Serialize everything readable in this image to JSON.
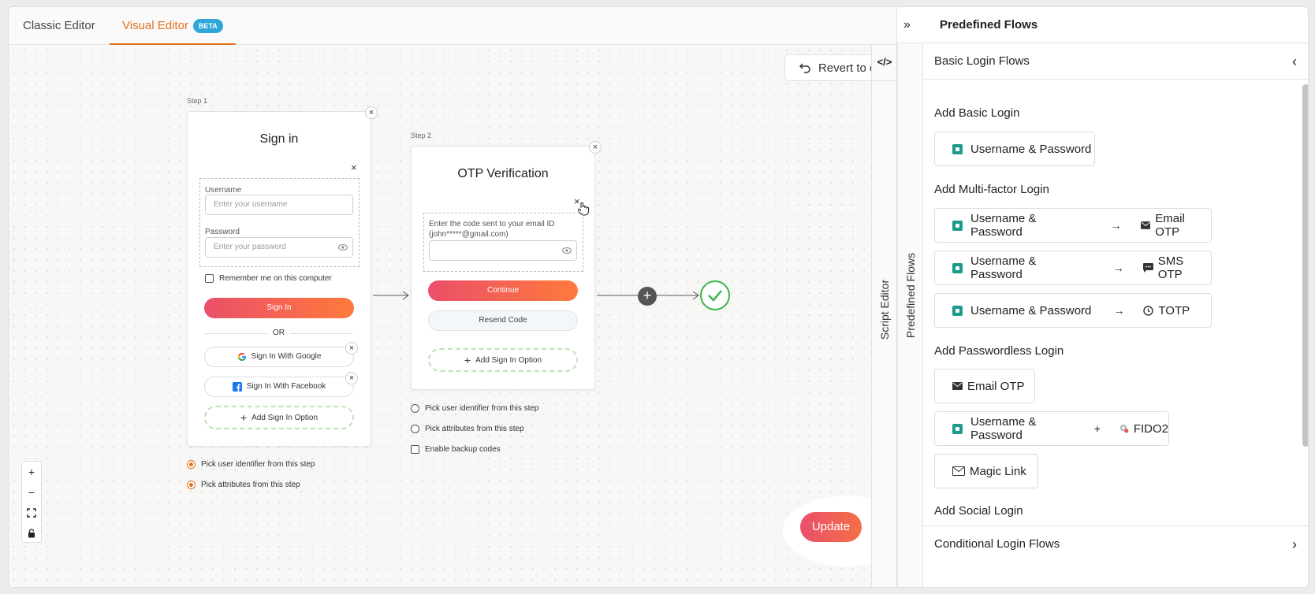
{
  "tabs": {
    "classic": "Classic Editor",
    "visual": "Visual Editor",
    "beta": "BETA"
  },
  "toolbar": {
    "revert": "Revert to default",
    "update": "Update"
  },
  "step1": {
    "label": "Step 1",
    "title": "Sign in",
    "username_label": "Username",
    "username_placeholder": "Enter your username",
    "password_label": "Password",
    "password_placeholder": "Enter your password",
    "remember": "Remember me on this computer",
    "sign_in": "Sign In",
    "or": "OR",
    "google": "Sign In With Google",
    "facebook": "Sign In With Facebook",
    "add_option": "Add Sign In Option",
    "options": [
      {
        "label": "Pick user identifier from this step",
        "checked": true
      },
      {
        "label": "Pick attributes from this step",
        "checked": true
      }
    ]
  },
  "step2": {
    "label": "Step 2",
    "title": "OTP Verification",
    "code_label": "Enter the code sent to your email ID (john*****@gmail.com)",
    "continue": "Continue",
    "resend": "Resend Code",
    "add_option": "Add Sign In Option",
    "options": [
      {
        "label": "Pick user identifier from this step",
        "checked": false
      },
      {
        "label": "Pick attributes from this step",
        "checked": false
      },
      {
        "label": "Enable backup codes",
        "checked": false
      }
    ]
  },
  "side_tabs": {
    "script_editor": "Script Editor",
    "predefined_flows": "Predefined Flows"
  },
  "panel": {
    "title": "Predefined Flows",
    "basic_section": "Basic Login Flows",
    "conditional_section": "Conditional Login Flows",
    "groups": {
      "basic": "Add Basic Login",
      "mfa": "Add Multi-factor Login",
      "passwordless": "Add Passwordless Login",
      "social": "Add Social Login"
    },
    "basic_flow": "Username & Password",
    "mfa_flows": [
      {
        "first": "Username & Password",
        "joiner": "→",
        "second": "Email OTP"
      },
      {
        "first": "Username & Password",
        "joiner": "→",
        "second": "SMS OTP"
      },
      {
        "first": "Username & Password",
        "joiner": "→",
        "second": "TOTP"
      }
    ],
    "passwordless_flows": {
      "email_otp": "Email OTP",
      "fido_first": "Username & Password",
      "fido_joiner": "+",
      "fido_second": "FIDO2",
      "magic_link": "Magic Link"
    }
  },
  "colors": {
    "accent": "#e4701e",
    "gradient_start": "#ea4f6a",
    "gradient_end": "#ff7a3c",
    "success": "#3bb54a",
    "beta": "#2ea7d8",
    "lock": "#1c9b8c"
  }
}
